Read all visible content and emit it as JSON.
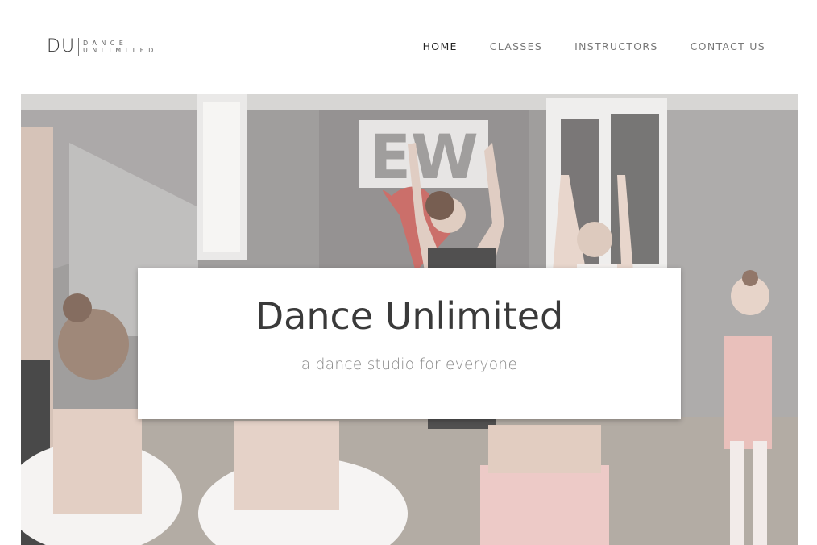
{
  "brand": {
    "mark": "DU",
    "line1": "DANCE",
    "line2": "UNLIMITED"
  },
  "nav": {
    "items": [
      {
        "label": "HOME",
        "active": true
      },
      {
        "label": "CLASSES",
        "active": false
      },
      {
        "label": "INSTRUCTORS",
        "active": false
      },
      {
        "label": "CONTACT US",
        "active": false
      }
    ]
  },
  "hero": {
    "title": "Dance Unlimited",
    "subtitle": "a dance studio for everyone",
    "wall_sign": "EW"
  },
  "colors": {
    "text_dark": "#3a3a3a",
    "text_muted": "#888888",
    "nav_active": "#222222",
    "nav_inactive": "#777777"
  }
}
